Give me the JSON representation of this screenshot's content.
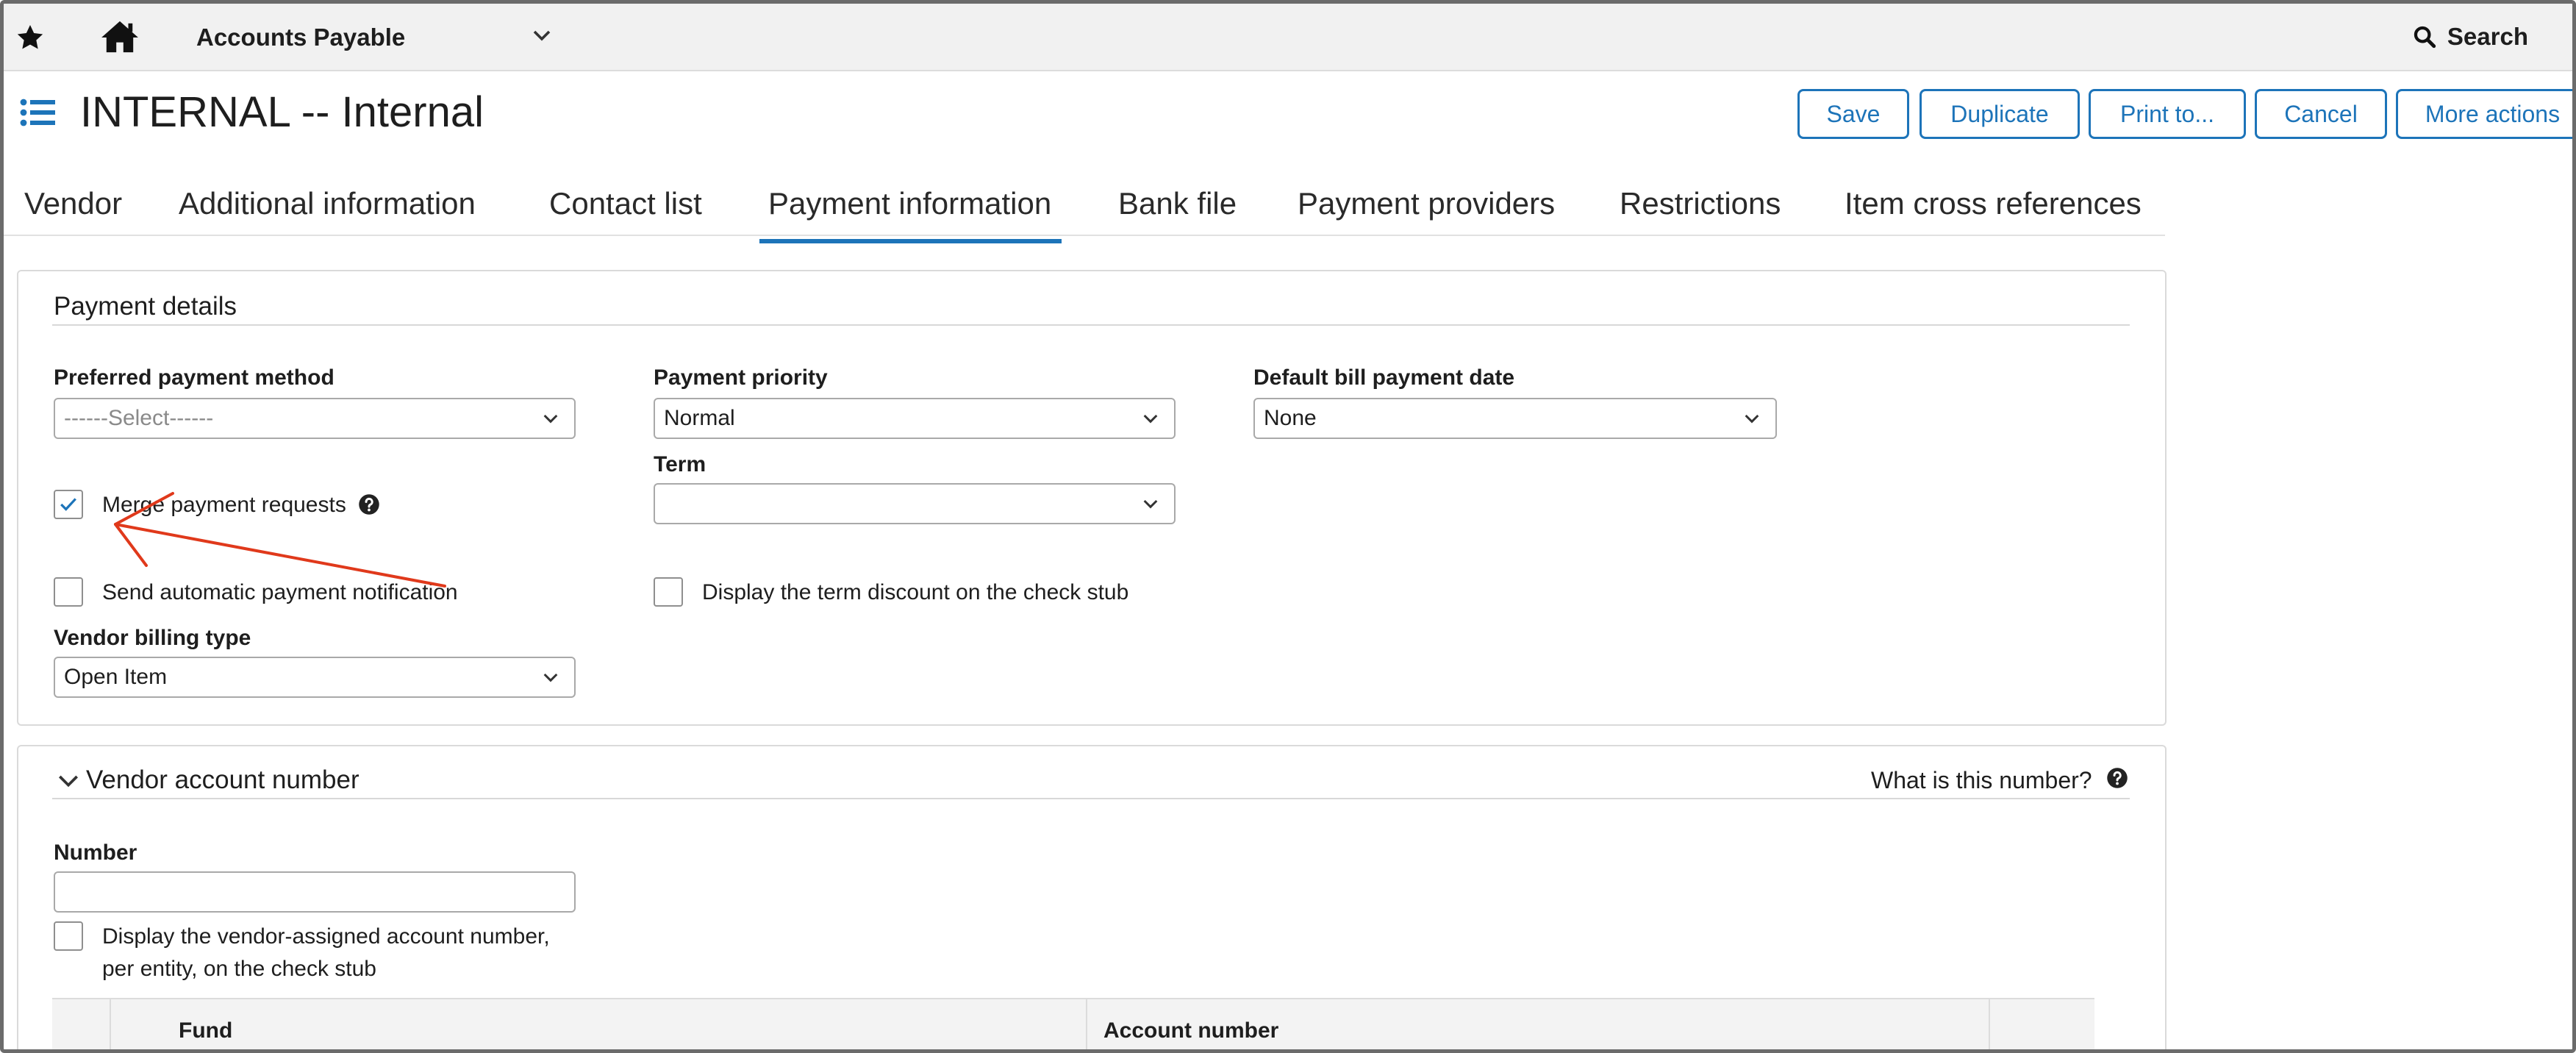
{
  "topbar": {
    "app_title": "Accounts Payable",
    "search_label": "Search",
    "icons": [
      "star-icon",
      "home-icon",
      "chevron-down-icon",
      "search-icon"
    ]
  },
  "header": {
    "title": "INTERNAL -- Internal",
    "buttons": {
      "save": "Save",
      "duplicate": "Duplicate",
      "print": "Print to...",
      "cancel": "Cancel",
      "more": "More actions"
    }
  },
  "tabs": [
    {
      "label": "Vendor"
    },
    {
      "label": "Additional information"
    },
    {
      "label": "Contact list"
    },
    {
      "label": "Payment information",
      "active": true
    },
    {
      "label": "Bank file"
    },
    {
      "label": "Payment providers"
    },
    {
      "label": "Restrictions"
    },
    {
      "label": "Item cross references"
    }
  ],
  "payment_details": {
    "title": "Payment details",
    "preferred_method": {
      "label": "Preferred payment method",
      "value": "------Select------"
    },
    "priority": {
      "label": "Payment priority",
      "value": "Normal"
    },
    "default_date": {
      "label": "Default bill payment date",
      "value": "None"
    },
    "term": {
      "label": "Term",
      "value": ""
    },
    "merge": {
      "label": "Merge payment requests",
      "checked": true
    },
    "auto_notify": {
      "label": "Send automatic payment notification",
      "checked": false
    },
    "term_discount": {
      "label": "Display the term discount on the check stub",
      "checked": false
    },
    "billing_type": {
      "label": "Vendor billing type",
      "value": "Open Item"
    }
  },
  "vendor_account": {
    "title": "Vendor account number",
    "help_link": "What is this number?",
    "number_label": "Number",
    "number_value": "",
    "display_assigned": {
      "line1": "Display the vendor-assigned account number,",
      "line2": "per entity, on the check stub",
      "checked": false
    },
    "table_columns": [
      "Fund",
      "Account number"
    ]
  },
  "colors": {
    "accent": "#1d74b9",
    "annotation_arrow": "#e0391b"
  }
}
